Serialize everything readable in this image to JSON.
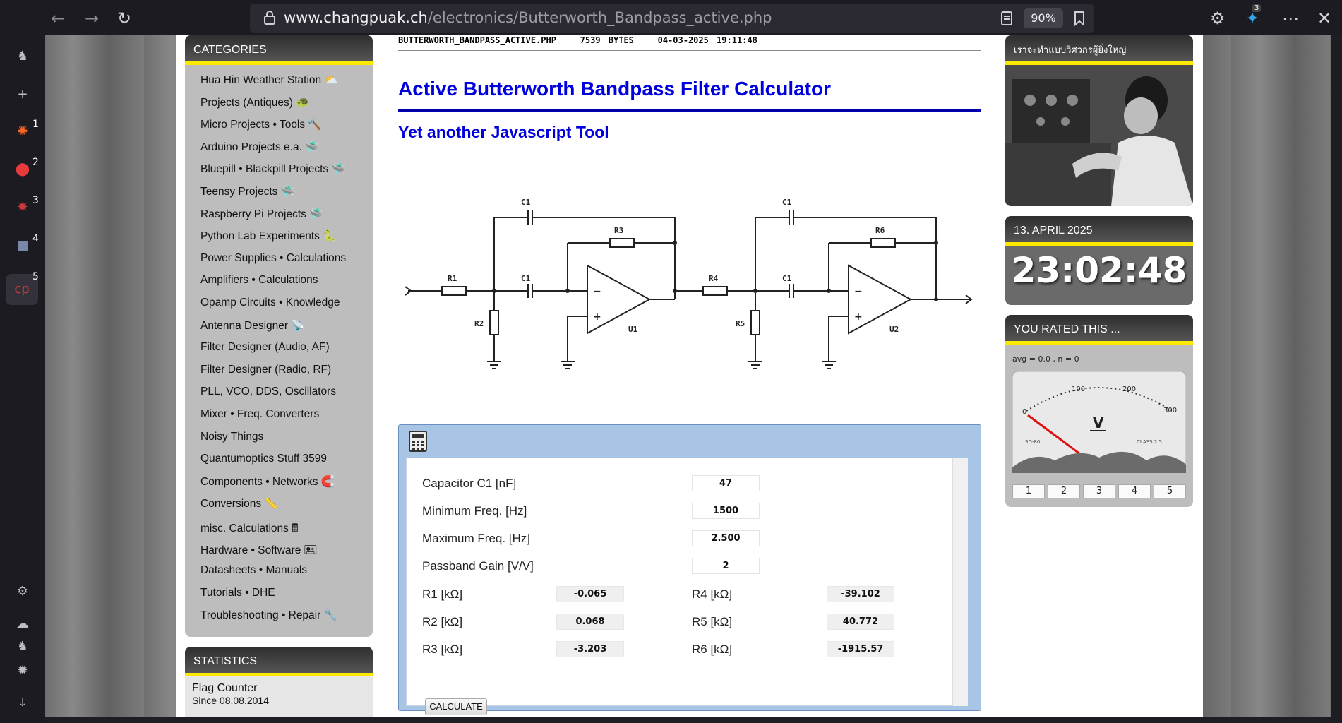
{
  "browser": {
    "url_host": "www.changpuak.ch",
    "url_path": "/electronics/Butterworth_Bandpass_active.php",
    "zoom": "90%",
    "ext_badge": "3",
    "icons": [
      "back-icon",
      "forward-icon",
      "reload-icon",
      "lock-icon",
      "reader-icon",
      "bookmark-icon",
      "extensions-icon",
      "menu-icon",
      "close-icon"
    ],
    "sidebar_badges": [
      "1",
      "2",
      "3",
      "4",
      "5"
    ]
  },
  "categories": {
    "title": "CATEGORIES",
    "items": [
      "Hua Hin Weather Station ⛅",
      "Projects (Antiques) 🐢",
      "Micro Projects • Tools 🔨",
      "Arduino Projects e.a. 🛸",
      "Bluepill • Blackpill Projects 🛸",
      "Teensy Projects 🛸",
      "Raspberry Pi Projects 🛸",
      "Python Lab Experiments 🐍",
      "Power Supplies • Calculations",
      "Amplifiers • Calculations",
      "Opamp Circuits • Knowledge",
      "Antenna Designer 📡",
      "Filter Designer (Audio, AF)",
      "Filter Designer (Radio, RF)",
      "PLL, VCO, DDS, Oscillators",
      "Mixer • Freq. Converters",
      "Noisy Things",
      "Quantumoptics Stuff 3599",
      "Components • Networks 🧲",
      "Conversions 📏",
      "misc. Calculations 🖩",
      "Hardware • Software 🖭",
      "Datasheets • Manuals",
      "Tutorials • DHE",
      "Troubleshooting • Repair 🔧"
    ]
  },
  "statistics": {
    "title": "STATISTICS",
    "counter": "Flag Counter",
    "since": "Since 08.08.2014"
  },
  "file": {
    "name": "BUTTERWORTH_BANDPASS_ACTIVE.PHP",
    "size": "7539 BYTES",
    "date": "04-03-2025 19:11:48"
  },
  "title": "Active Butterworth Bandpass Filter Calculator",
  "subtitle": "Yet another Javascript Tool",
  "circuit": {
    "labels": [
      "C1",
      "R3",
      "C1",
      "R6",
      "R1",
      "C1",
      "R4",
      "C1",
      "R2",
      "U1",
      "R5",
      "U2"
    ],
    "opamp_signs": [
      "−",
      "+"
    ]
  },
  "calculator": {
    "inputs": [
      {
        "label": "Capacitor C1 [nF]",
        "value": "47"
      },
      {
        "label": "Minimum Freq. [Hz]",
        "value": "1500"
      },
      {
        "label": "Maximum Freq. [Hz]",
        "value": "2.500"
      },
      {
        "label": "Passband Gain [V/V]",
        "value": "2"
      }
    ],
    "outputs_left": [
      {
        "label": "R1 [kΩ]",
        "value": "-0.065"
      },
      {
        "label": "R2 [kΩ]",
        "value": "0.068"
      },
      {
        "label": "R3 [kΩ]",
        "value": "-3.203"
      }
    ],
    "outputs_right": [
      {
        "label": "R4 [kΩ]",
        "value": "-39.102"
      },
      {
        "label": "R5 [kΩ]",
        "value": "40.772"
      },
      {
        "label": "R6 [kΩ]",
        "value": "-1915.57"
      }
    ],
    "button": "CALCULATE"
  },
  "right": {
    "banner": "เราจะทำแบบวิศวกรผู้ยิ่งใหญ่",
    "date": "13. APRIL 2025",
    "time": "23:02:48",
    "rating_title": "YOU RATED THIS ...",
    "rating_stats": "avg = 0.0 ,  n = 0",
    "meter_unit": "V",
    "meter_scale": [
      "0",
      "100",
      "200",
      "300"
    ],
    "meter_small_left": "SD-80",
    "meter_small_right": "CLASS 2.5",
    "rating_buttons": [
      "1",
      "2",
      "3",
      "4",
      "5"
    ]
  }
}
